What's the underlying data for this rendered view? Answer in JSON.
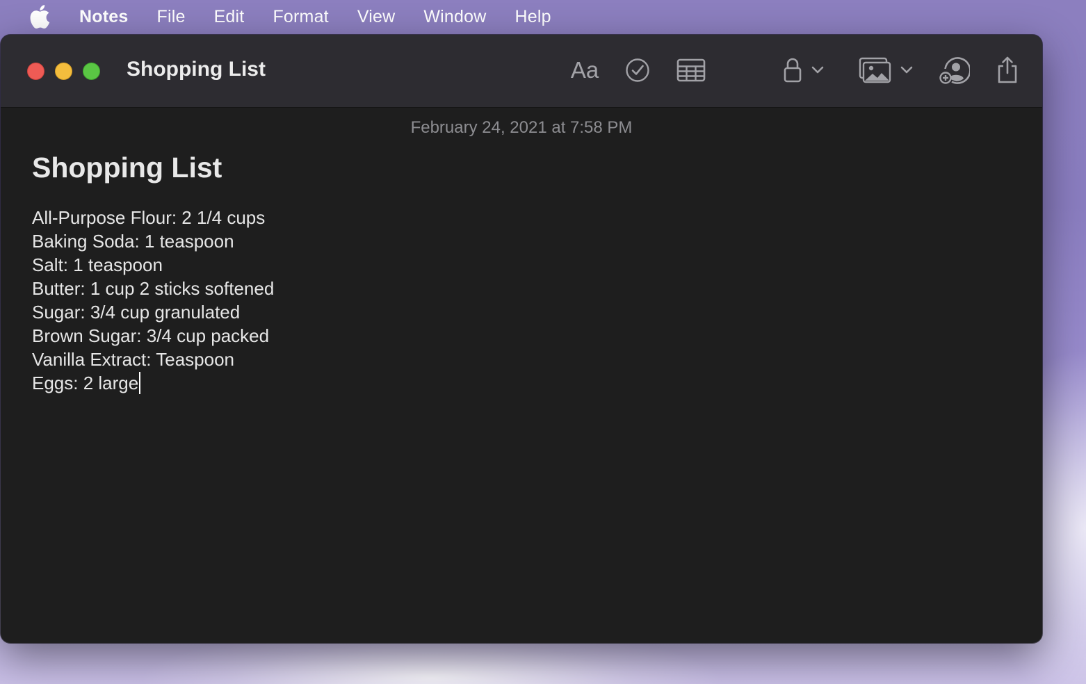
{
  "menubar": {
    "apple_icon": "apple-logo-icon",
    "items": [
      "Notes",
      "File",
      "Edit",
      "Format",
      "View",
      "Window",
      "Help"
    ]
  },
  "window": {
    "title": "Shopping List",
    "toolbar": {
      "format_label": "Aa",
      "icons": [
        "checklist-icon",
        "table-icon",
        "lock-icon",
        "media-icon",
        "add-people-icon",
        "share-icon"
      ]
    }
  },
  "note": {
    "date": "February 24, 2021 at 7:58 PM",
    "heading": "Shopping List",
    "lines": [
      "All-Purpose Flour: 2 1/4 cups",
      "Baking Soda: 1 teaspoon",
      "Salt: 1 teaspoon",
      "Butter: 1 cup 2 sticks softened",
      "Sugar: 3/4 cup granulated",
      "Brown Sugar: 3/4 cup packed",
      "Vanilla Extract: Teaspoon",
      "Eggs: 2 large"
    ]
  },
  "colors": {
    "close": "#ee5b55",
    "minimize": "#f4bd3d",
    "zoom": "#5ac644",
    "note_background": "#1e1e1e",
    "toolbar_background": "#2d2c31"
  }
}
